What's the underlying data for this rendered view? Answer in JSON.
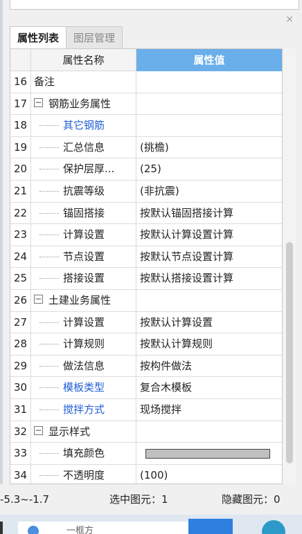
{
  "panel": {
    "close_glyph": "×",
    "tabs": [
      {
        "label": "属性列表",
        "active": true
      },
      {
        "label": "图层管理",
        "active": false
      }
    ],
    "header": {
      "name": "属性名称",
      "value": "属性值"
    }
  },
  "rows": [
    {
      "num": "16",
      "name": "备注",
      "value": "",
      "kind": "top"
    },
    {
      "num": "17",
      "name": "钢筋业务属性",
      "value": "",
      "kind": "group"
    },
    {
      "num": "18",
      "name": "其它钢筋",
      "value": "",
      "kind": "child",
      "link": true
    },
    {
      "num": "19",
      "name": "汇总信息",
      "value": "(挑檐)",
      "kind": "child"
    },
    {
      "num": "20",
      "name": "保护层厚...",
      "value": "(25)",
      "kind": "child"
    },
    {
      "num": "21",
      "name": "抗震等级",
      "value": "(非抗震)",
      "kind": "child"
    },
    {
      "num": "22",
      "name": "锚固搭接",
      "value": "按默认锚固搭接计算",
      "kind": "child"
    },
    {
      "num": "23",
      "name": "计算设置",
      "value": "按默认计算设置计算",
      "kind": "child"
    },
    {
      "num": "24",
      "name": "节点设置",
      "value": "按默认节点设置计算",
      "kind": "child"
    },
    {
      "num": "25",
      "name": "搭接设置",
      "value": "按默认搭接设置计算",
      "kind": "child"
    },
    {
      "num": "26",
      "name": "土建业务属性",
      "value": "",
      "kind": "group"
    },
    {
      "num": "27",
      "name": "计算设置",
      "value": "按默认计算设置",
      "kind": "child"
    },
    {
      "num": "28",
      "name": "计算规则",
      "value": "按默认计算规则",
      "kind": "child"
    },
    {
      "num": "29",
      "name": "做法信息",
      "value": "按构件做法",
      "kind": "child"
    },
    {
      "num": "30",
      "name": "模板类型",
      "value": "复合木模板",
      "kind": "child",
      "link": true
    },
    {
      "num": "31",
      "name": "搅拌方式",
      "value": "现场搅拌",
      "kind": "child",
      "link": true
    },
    {
      "num": "32",
      "name": "显示样式",
      "value": "",
      "kind": "group"
    },
    {
      "num": "33",
      "name": "填充颜色",
      "value": "",
      "kind": "child",
      "swatch": "#c0c0c0"
    },
    {
      "num": "34",
      "name": "不透明度",
      "value": "(100)",
      "kind": "child"
    }
  ],
  "status": {
    "range": "-5.3~-1.7",
    "selected": "选中图元：1",
    "hidden": "隐藏图元：0"
  },
  "taskbar": {
    "search_text": "一框方"
  },
  "colors": {
    "header_value_bg": "#6aaeea",
    "link_text": "#1f5fd6"
  }
}
